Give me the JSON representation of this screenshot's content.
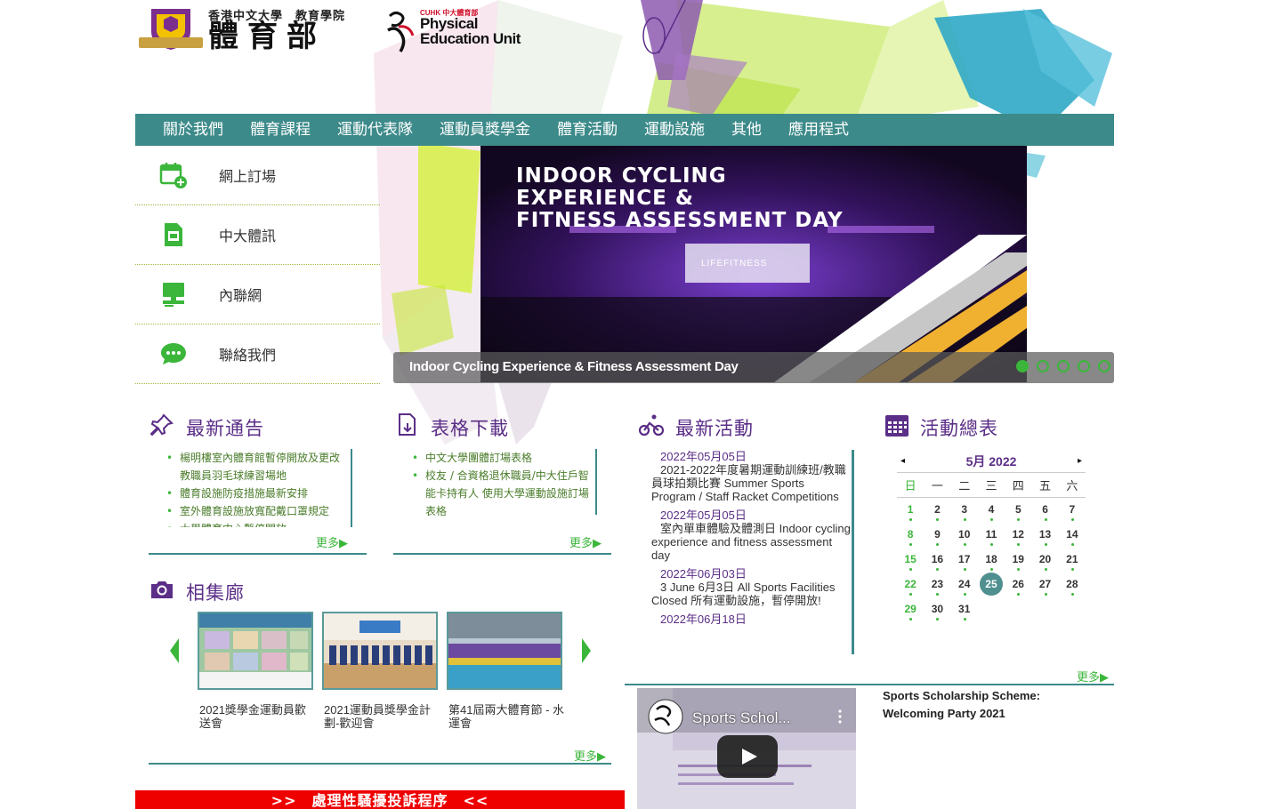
{
  "header": {
    "university_name": "香港中文大學　教育學院",
    "unit_name_zh": "體育部",
    "logo_small_text": "CUHK 中大體育部",
    "logo_text_line1": "Physical",
    "logo_text_line2": "Education Unit"
  },
  "nav": {
    "items": [
      "關於我們",
      "體育課程",
      "運動代表隊",
      "運動員獎學金",
      "體育活動",
      "運動設施",
      "其他",
      "應用程式"
    ]
  },
  "quick_links": [
    {
      "label": "網上訂場",
      "icon": "calendar-add-icon"
    },
    {
      "label": "中大體訊",
      "icon": "document-icon"
    },
    {
      "label": "內聯網",
      "icon": "computer-icon"
    },
    {
      "label": "聯絡我們",
      "icon": "chat-icon"
    }
  ],
  "banner": {
    "title_line1": "INDOOR CYCLING",
    "title_line2": "EXPERIENCE &",
    "title_line3": "FITNESS ASSESSMENT DAY",
    "brand": "LIFEFITNESS",
    "caption": "Indoor Cycling Experience & Fitness Assessment Day",
    "slide_count": 5,
    "active_slide": 1
  },
  "news": {
    "title": "最新通告",
    "items": [
      "楊明樓室內體育館暫停開放及更改教職員羽毛球練習場地",
      "體育設施防疫措施最新安排",
      "室外體育設施放寬配戴口罩規定",
      "大學體育中心暫停開放"
    ],
    "more": "更多▶"
  },
  "forms": {
    "title": "表格下載",
    "items": [
      "中文大學團體訂場表格",
      "校友 / 合資格退休職員/中大住戶智能卡持有人 使用大學運動設施訂場表格"
    ],
    "more": "更多▶"
  },
  "events": {
    "title": "最新活動",
    "items": [
      {
        "date": "2022年05月05日",
        "title": "2021-2022年度暑期運動訓練班/教職員球拍類比賽 Summer Sports Program / Staff Racket Competitions"
      },
      {
        "date": "2022年05月05日",
        "title": "室內單車體驗及體測日 Indoor cycling experience and fitness assessment day"
      },
      {
        "date": "2022年06月03日",
        "title": "3 June 6月3日 All Sports Facilities Closed 所有運動設施，暫停開放!"
      },
      {
        "date": "2022年06月18日",
        "title": ""
      }
    ],
    "more": "更多▶"
  },
  "calendar": {
    "title": "活動總表",
    "month": "5月 2022",
    "prev": "◂",
    "next": "▸",
    "weekdays": [
      "日",
      "一",
      "二",
      "三",
      "四",
      "五",
      "六"
    ],
    "weeks": [
      [
        "1",
        "2",
        "3",
        "4",
        "5",
        "6",
        "7"
      ],
      [
        "8",
        "9",
        "10",
        "11",
        "12",
        "13",
        "14"
      ],
      [
        "15",
        "16",
        "17",
        "18",
        "19",
        "20",
        "21"
      ],
      [
        "22",
        "23",
        "24",
        "25",
        "26",
        "27",
        "28"
      ],
      [
        "29",
        "30",
        "31",
        "",
        "",
        "",
        ""
      ]
    ],
    "today": "25"
  },
  "gallery": {
    "title": "相集廊",
    "items": [
      {
        "caption": "2021獎學金運動員歡送會"
      },
      {
        "caption": "2021運動員獎學金計劃-歡迎會"
      },
      {
        "caption": "第41屆兩大體育節 - 水運會"
      }
    ],
    "more": "更多▶"
  },
  "video": {
    "overlay_title": "Sports Schol...",
    "description": "Sports Scholarship Scheme: Welcoming Party 2021"
  },
  "complaint": {
    "label": ">>　處理性騷擾投訴程序　<<"
  },
  "colors": {
    "nav_bg": "#3d8a8a",
    "accent_green": "#3bb63b",
    "title_purple": "#5b2e87",
    "complaint_red": "#ee0000"
  }
}
